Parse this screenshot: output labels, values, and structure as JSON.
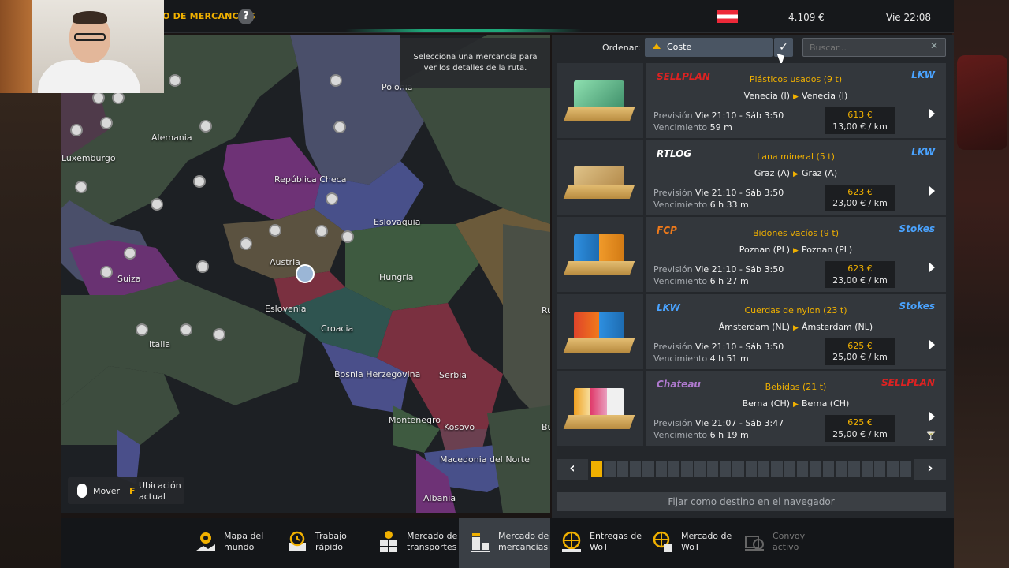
{
  "topbar": {
    "title": "O DE MERCANCÍAS",
    "help": "?",
    "money": "4.109 €",
    "clock": "Vie 22:08"
  },
  "map": {
    "tooltip": "Selecciona una mercancía para ver los detalles de la ruta.",
    "labels": {
      "polonia": "Polonia",
      "alemania": "Alemania",
      "luxemburgo": "Luxemburgo",
      "republica_checa": "República Checa",
      "eslovaquia": "Eslovaquia",
      "austria": "Austria",
      "suiza": "Suiza",
      "hungria": "Hungría",
      "eslovenia": "Eslovenia",
      "croacia": "Croacia",
      "italia": "Italia",
      "bosnia": "Bosnia Herzegovina",
      "serbia": "Serbia",
      "montenegro": "Montenegro",
      "kosovo": "Kosovo",
      "macedonia": "Macedonia del Norte",
      "albania": "Albania",
      "ru": "Ru",
      "bu": "Bu"
    },
    "controls": {
      "move": "Mover",
      "key": "F",
      "location": "Ubicación actual"
    }
  },
  "panel": {
    "sort_label": "Ordenar:",
    "sort_value": "Coste",
    "search_placeholder": "Buscar...",
    "cargos": [
      {
        "company_left": "SELLPLAN",
        "company_right": "LKW",
        "name": "Plásticos usados (9 t)",
        "origin": "Venecia (I)",
        "dest": "Venecia (I)",
        "forecast_label": "Previsión",
        "forecast": "Vie 21:10 - Sáb 3:50",
        "expiry_label": "Vencimiento",
        "expiry": "59 m",
        "price": "613 €",
        "rate": "13,00 € / km"
      },
      {
        "company_left": "RTLOG",
        "company_right": "LKW",
        "name": "Lana mineral (5 t)",
        "origin": "Graz (A)",
        "dest": "Graz (A)",
        "forecast_label": "Previsión",
        "forecast": "Vie 21:10 - Sáb 3:50",
        "expiry_label": "Vencimiento",
        "expiry": "6 h 33 m",
        "price": "623 €",
        "rate": "23,00 € / km"
      },
      {
        "company_left": "FCP",
        "company_right": "Stokes",
        "name": "Bidones vacíos (9 t)",
        "origin": "Poznan (PL)",
        "dest": "Poznan (PL)",
        "forecast_label": "Previsión",
        "forecast": "Vie 21:10 - Sáb 3:50",
        "expiry_label": "Vencimiento",
        "expiry": "6 h 27 m",
        "price": "623 €",
        "rate": "23,00 € / km"
      },
      {
        "company_left": "LKW",
        "company_right": "Stokes",
        "name": "Cuerdas de nylon (23 t)",
        "origin": "Ámsterdam (NL)",
        "dest": "Ámsterdam (NL)",
        "forecast_label": "Previsión",
        "forecast": "Vie 21:10 - Sáb 3:50",
        "expiry_label": "Vencimiento",
        "expiry": "4 h 51 m",
        "price": "625 €",
        "rate": "25,00 € / km"
      },
      {
        "company_left": "Chateau",
        "company_right": "SELLPLAN",
        "name": "Bebidas (21 t)",
        "origin": "Berna (CH)",
        "dest": "Berna (CH)",
        "forecast_label": "Previsión",
        "forecast": "Vie 21:07 - Sáb 3:47",
        "expiry_label": "Vencimiento",
        "expiry": "6 h 19 m",
        "price": "625 €",
        "rate": "25,00 € / km"
      }
    ],
    "gps_button": "Fijar como destino en el navegador"
  },
  "bottom_nav": [
    {
      "label1": "Mapa del",
      "label2": "mundo"
    },
    {
      "label1": "Trabajo",
      "label2": "rápido"
    },
    {
      "label1": "Mercado de",
      "label2": "transportes"
    },
    {
      "label1": "Mercado de",
      "label2": "mercancías"
    },
    {
      "label1": "Entregas de",
      "label2": "WoT"
    },
    {
      "label1": "Mercado de",
      "label2": "WoT"
    },
    {
      "label1": "Convoy",
      "label2": "activo"
    }
  ],
  "colors": {
    "accent": "#f0b000",
    "panel": "#24272b",
    "card": "#33373c"
  }
}
